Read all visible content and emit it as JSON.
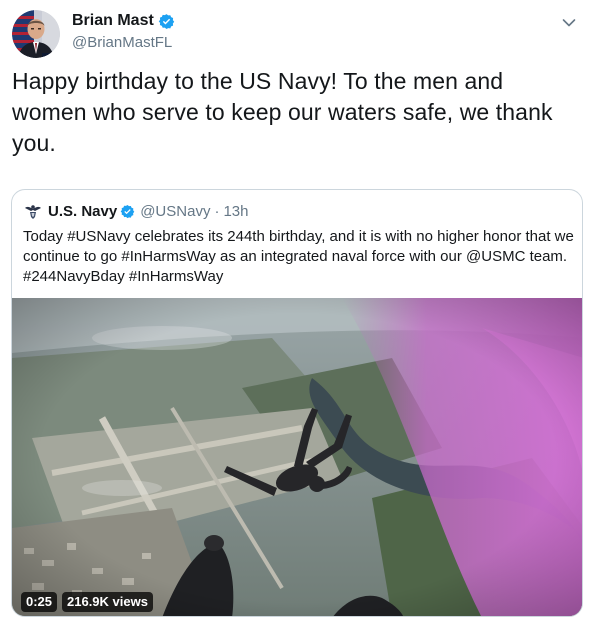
{
  "author": {
    "name": "Brian Mast",
    "handle": "@BrianMastFL",
    "verified": true
  },
  "tweet": {
    "text": "Happy birthday to the US Navy! To the men and women who serve to keep our waters safe, we thank you."
  },
  "quoted": {
    "name": "U.S. Navy",
    "handle": "@USNavy",
    "separator": "·",
    "time": "13h",
    "text": "Today #USNavy celebrates its 244th birthday, and it is with no higher honor that we continue to go #InHarmsWay as an integrated naval force with our @USMC team. #244NavyBday #InHarmsWay"
  },
  "media": {
    "duration": "0:25",
    "views": "216.9K views"
  },
  "colors": {
    "verified_blue": "#1da1f2",
    "text_primary": "#14171a",
    "text_secondary": "#657786",
    "border": "#ccd6dd"
  },
  "icons": {
    "verified": "verified-badge-icon",
    "menu": "chevron-down-icon",
    "quoted_logo": "navy-eagle-logo"
  }
}
